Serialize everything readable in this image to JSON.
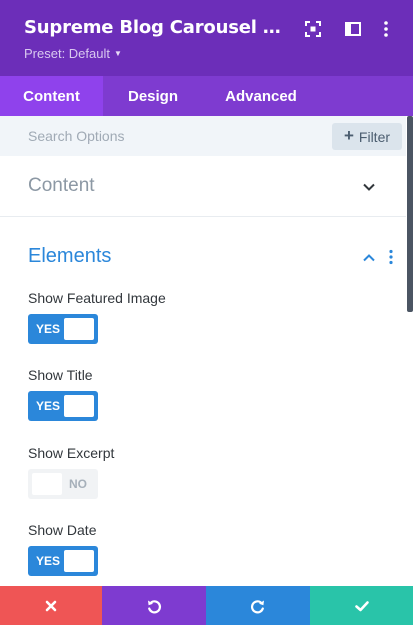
{
  "header": {
    "title": "Supreme Blog Carousel Settings",
    "preset_label": "Preset: Default",
    "icons": [
      "expand-icon",
      "sidebar-layout-icon",
      "more-options-icon"
    ],
    "bg_color": "#6c2eb9"
  },
  "tabs": [
    {
      "label": "Content",
      "active": true
    },
    {
      "label": "Design",
      "active": false
    },
    {
      "label": "Advanced",
      "active": false
    }
  ],
  "search": {
    "placeholder": "Search Options",
    "value": "",
    "filter_label": "Filter"
  },
  "sections": {
    "content": {
      "title": "Content",
      "expanded": false
    },
    "elements": {
      "title": "Elements",
      "expanded": true
    }
  },
  "options": [
    {
      "label": "Show Featured Image",
      "state": "YES",
      "on": true
    },
    {
      "label": "Show Title",
      "state": "YES",
      "on": true
    },
    {
      "label": "Show Excerpt",
      "state": "NO",
      "on": false
    },
    {
      "label": "Show Date",
      "state": "YES",
      "on": true
    }
  ],
  "footer": {
    "buttons": [
      {
        "name": "cancel",
        "icon": "close-icon",
        "color": "#ef5555"
      },
      {
        "name": "undo",
        "icon": "undo-icon",
        "color": "#7e3bd0"
      },
      {
        "name": "redo",
        "icon": "redo-icon",
        "color": "#2b87da"
      },
      {
        "name": "save",
        "icon": "checkmark-icon",
        "color": "#29c4a9"
      }
    ]
  },
  "colors": {
    "accent_blue": "#2b87da",
    "purple": "#7e3bd0",
    "purple_active_tab": "#8f42ec",
    "danger": "#ef5555",
    "success": "#29c4a9"
  }
}
